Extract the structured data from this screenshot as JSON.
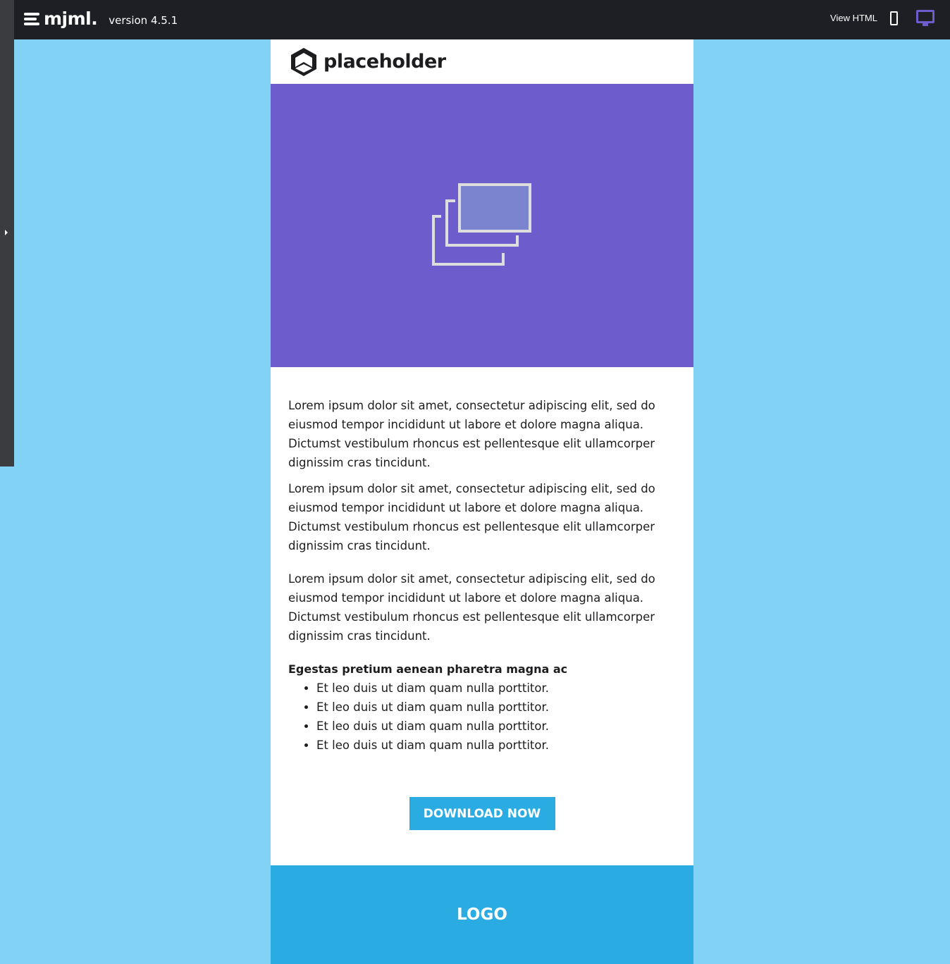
{
  "topbar": {
    "brand": "mjml.",
    "version": "version 4.5.1",
    "view_html": "View HTML"
  },
  "header": {
    "logo_text": "placeholder"
  },
  "content": {
    "paragraphs": [
      "Lorem ipsum dolor sit amet, consectetur adipiscing elit, sed do eiusmod tempor incididunt ut labore et dolore magna aliqua. Dictumst vestibulum rhoncus est pellentesque elit ullamcorper dignissim cras tincidunt.",
      "Lorem ipsum dolor sit amet, consectetur adipiscing elit, sed do eiusmod tempor incididunt ut labore et dolore magna aliqua. Dictumst vestibulum rhoncus est pellentesque elit ullamcorper dignissim cras tincidunt.",
      "Lorem ipsum dolor sit amet, consectetur adipiscing elit, sed do eiusmod tempor incididunt ut labore et dolore magna aliqua. Dictumst vestibulum rhoncus est pellentesque elit ullamcorper dignissim cras tincidunt."
    ],
    "list_title": "Egestas pretium aenean pharetra magna ac",
    "list": [
      "Et leo duis ut diam quam nulla porttitor.",
      "Et leo duis ut diam quam nulla porttitor.",
      "Et leo duis ut diam quam nulla porttitor.",
      "Et leo duis ut diam quam nulla porttitor."
    ],
    "button": "DOWNLOAD NOW"
  },
  "footer": {
    "logo": "LOGO"
  },
  "colors": {
    "hero": "#6c5ccc",
    "accent": "#2aace2",
    "background": "#82d2f6"
  }
}
